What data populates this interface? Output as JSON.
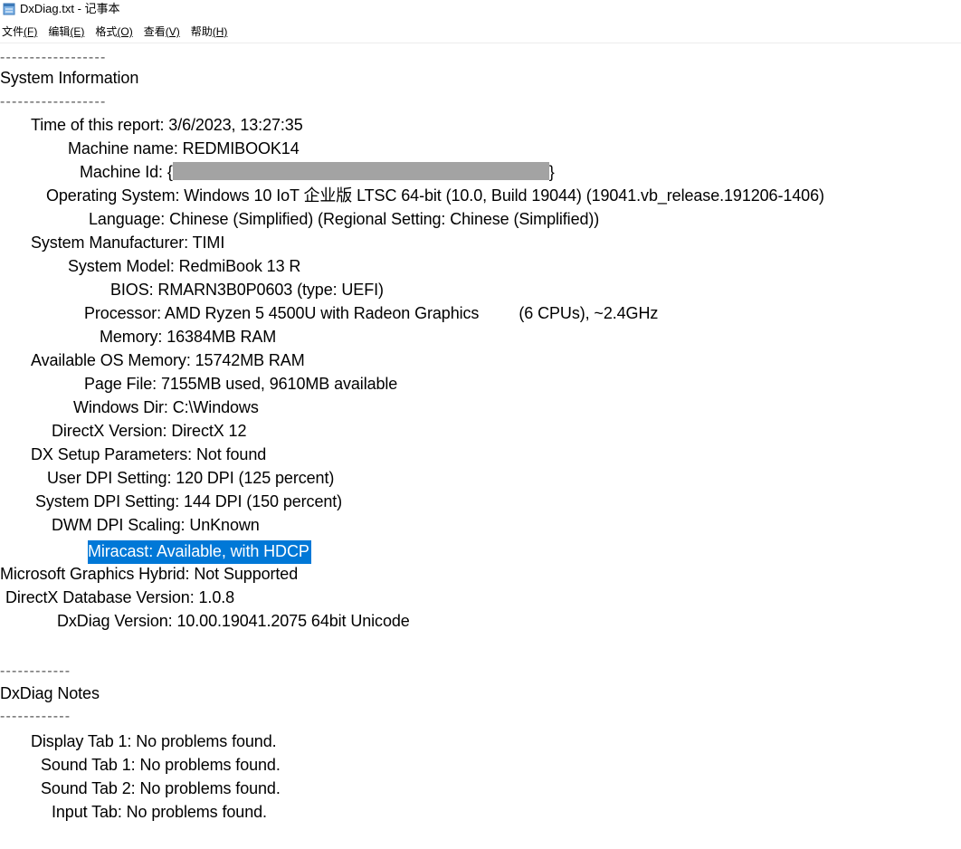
{
  "window": {
    "title": "DxDiag.txt - 记事本"
  },
  "menu": [
    {
      "label": "文件",
      "accel": "(F)"
    },
    {
      "label": "编辑",
      "accel": "(E)"
    },
    {
      "label": "格式",
      "accel": "(O)"
    },
    {
      "label": "查看",
      "accel": "(V)"
    },
    {
      "label": "帮助",
      "accel": "(H)"
    }
  ],
  "content": {
    "sys_dash_top": "------------------",
    "sys_heading": "System Information",
    "sys_dash_bottom": "------------------",
    "time": "Time of this report: 3/6/2023, 13:27:35",
    "machine_name": "Machine name: REDMIBOOK14",
    "machine_id_prefix": "Machine Id: {",
    "machine_id_suffix": "}",
    "os": "Operating System: Windows 10 IoT 企业版 LTSC 64-bit (10.0, Build 19044) (19041.vb_release.191206-1406)",
    "language": "Language: Chinese (Simplified) (Regional Setting: Chinese (Simplified))",
    "manufacturer": "System Manufacturer: TIMI",
    "model": "System Model: RedmiBook 13 R",
    "bios": "BIOS: RMARN3B0P0603 (type: UEFI)",
    "processor": "Processor: AMD Ryzen 5 4500U with Radeon Graphics         (6 CPUs), ~2.4GHz",
    "memory": "Memory: 16384MB RAM",
    "avail_memory": "Available OS Memory: 15742MB RAM",
    "page_file": "Page File: 7155MB used, 9610MB available",
    "windows_dir": "Windows Dir: C:\\Windows",
    "directx_version": "DirectX Version: DirectX 12",
    "dx_setup": "DX Setup Parameters: Not found",
    "user_dpi": "User DPI Setting: 120 DPI (125 percent)",
    "system_dpi": "System DPI Setting: 144 DPI (150 percent)",
    "dwm_dpi": "DWM DPI Scaling: UnKnown",
    "miracast": "Miracast: Available, with HDCP",
    "hybrid": "Microsoft Graphics Hybrid: Not Supported",
    "db_version": "DirectX Database Version: 1.0.8",
    "dxdiag_version": "DxDiag Version: 10.00.19041.2075 64bit Unicode",
    "notes_dash_top": "------------",
    "notes_heading": "DxDiag Notes",
    "notes_dash_bottom": "------------",
    "display_tab": "Display Tab 1: No problems found.",
    "sound_tab_1": "Sound Tab 1: No problems found.",
    "sound_tab_2": "Sound Tab 2: No problems found.",
    "input_tab": "Input Tab: No problems found."
  },
  "colors": {
    "selection": "#0078d7",
    "redaction": "#a3a3a3"
  },
  "icons": {
    "app_icon": "notepad-icon"
  }
}
